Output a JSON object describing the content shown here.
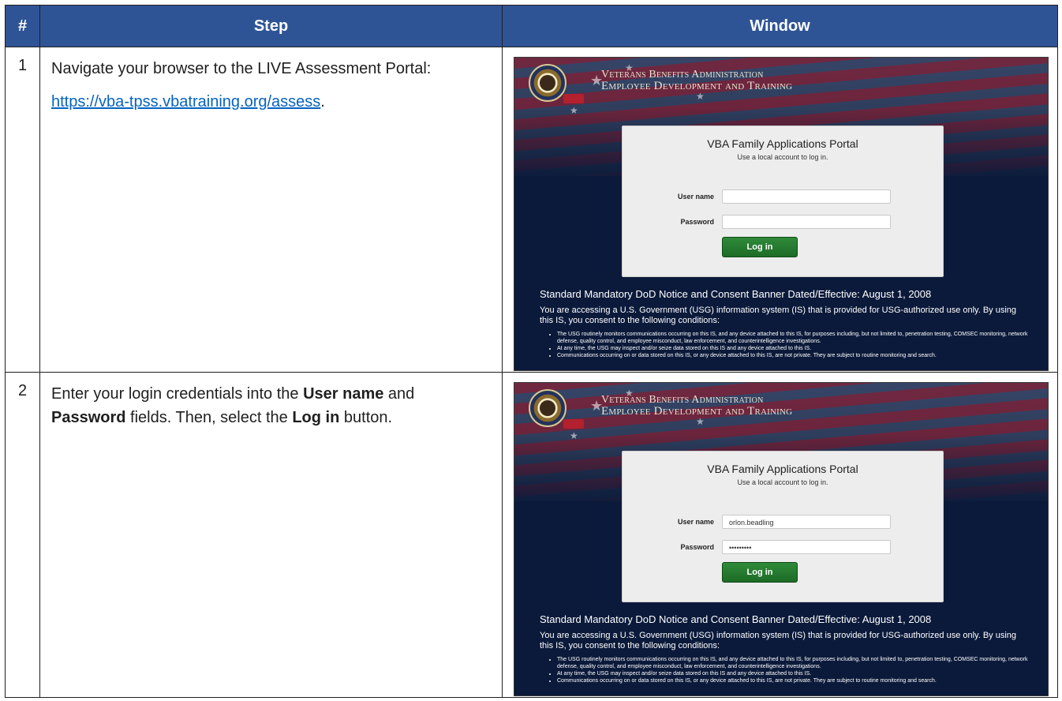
{
  "table": {
    "headers": {
      "num": "#",
      "step": "Step",
      "window": "Window"
    }
  },
  "rows": [
    {
      "num": "1",
      "text_1": "Navigate your browser to the LIVE Assessment Portal:",
      "link": "https://vba-tpss.vbatraining.org/assess",
      "link_suffix": "."
    },
    {
      "num": "2",
      "t1": "Enter your login credentials into the ",
      "b1": "User name",
      "t2": " and ",
      "b2": "Password",
      "t3": " fields. Then, select the ",
      "b3": "Log in",
      "t4": " button."
    }
  ],
  "portal": {
    "banner_line1": "Veterans Benefits Administration",
    "banner_line2": "Employee Development and Training",
    "badge": "EDT",
    "card_title": "VBA Family Applications Portal",
    "card_subtitle": "Use a local account to log in.",
    "username_label": "User name",
    "password_label": "Password",
    "login_button": "Log in",
    "notice_title": "Standard Mandatory DoD Notice and Consent Banner Dated/Effective: August 1, 2008",
    "notice_body": "You are accessing a U.S. Government (USG) information system (IS) that is provided for USG-authorized use only. By using this IS, you consent to the following conditions:",
    "bullets": [
      "The USG routinely monitors communications occurring on this IS, and any device attached to this IS, for purposes including, but not limited to, penetration testing, COMSEC monitoring, network defense, quality control, and employee misconduct, law enforcement, and counterintelligence investigations.",
      "At any time, the USG may inspect and/or seize data stored on this IS and any device attached to this IS.",
      "Communications occurring on or data stored on this IS, or any device attached to this IS, are not private. They are subject to routine monitoring and search."
    ]
  },
  "screenshot2": {
    "username_value": "orlon.beadling",
    "password_value": "•••••••••"
  },
  "colors": {
    "header_bg": "#2f5496",
    "link": "#0563c1",
    "button_green": "#1d6c27",
    "portal_bg": "#0b1a3a"
  }
}
